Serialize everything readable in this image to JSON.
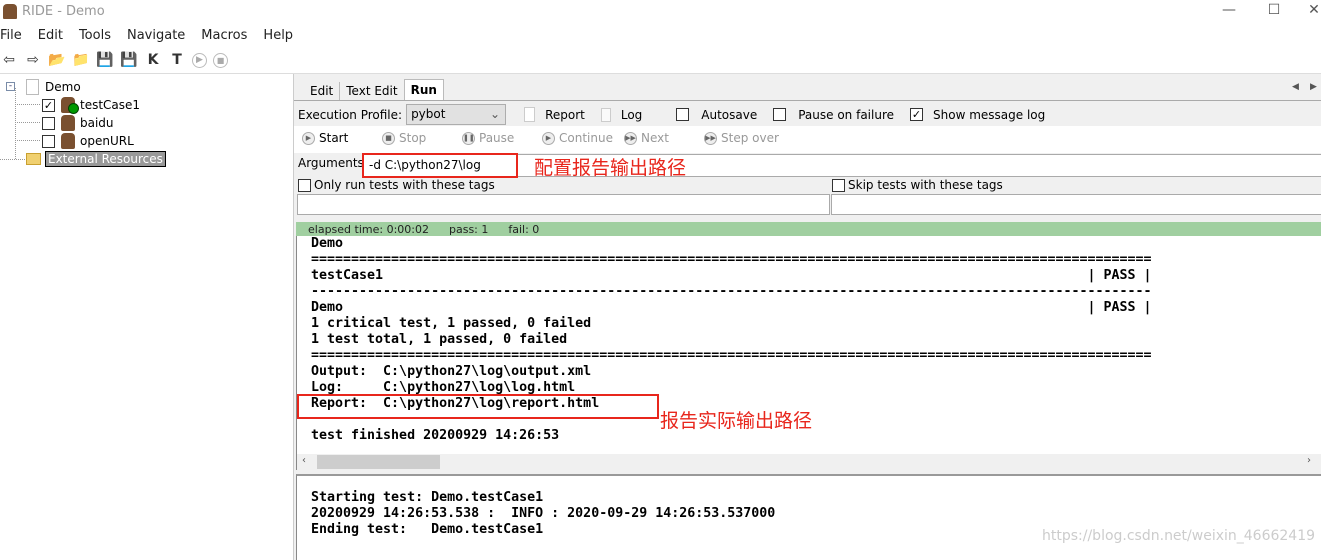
{
  "window": {
    "title": "RIDE - Demo",
    "controls": {
      "minimize": "—",
      "maximize": "☐",
      "close": "✕"
    }
  },
  "menu": [
    "File",
    "Edit",
    "Tools",
    "Navigate",
    "Macros",
    "Help"
  ],
  "toolbar": [
    {
      "icon": "back-arrow-icon",
      "glyph": "⇦"
    },
    {
      "icon": "forward-arrow-icon",
      "glyph": "⇨"
    },
    {
      "icon": "open-directory-icon",
      "glyph": "📂"
    },
    {
      "icon": "open-folder-icon",
      "glyph": "📁"
    },
    {
      "icon": "save-icon",
      "glyph": "💾"
    },
    {
      "icon": "save-all-icon",
      "glyph": "💾"
    },
    {
      "icon": "search-keywords-icon",
      "glyph": "K"
    },
    {
      "icon": "search-tests-icon",
      "glyph": "T"
    },
    {
      "icon": "run-icon",
      "glyph": "▶"
    },
    {
      "icon": "stop-icon",
      "glyph": "■"
    }
  ],
  "tree": {
    "root": "Demo",
    "items": [
      {
        "label": "testCase1",
        "checked": true,
        "status": "pass"
      },
      {
        "label": "baidu",
        "checked": false
      },
      {
        "label": "openURL",
        "checked": false
      }
    ],
    "external": "External Resources"
  },
  "tabs": [
    "Edit",
    "Text Edit",
    "Run"
  ],
  "tab_nav": {
    "left": "◀",
    "right": "▶"
  },
  "run": {
    "profile_label": "Execution Profile:",
    "profile_value": "pybot",
    "report": "Report",
    "log": "Log",
    "autosave": "Autosave",
    "autosave_checked": false,
    "pause_on_failure": "Pause on failure",
    "pause_checked": false,
    "show_message_log": "Show message log",
    "show_checked": true,
    "buttons": [
      "Start",
      "Stop",
      "Pause",
      "Continue",
      "Next",
      "Step over"
    ],
    "arguments_label": "Arguments:",
    "arguments_value": "-d C:\\python27\\log",
    "arguments_note": "配置报告输出路径",
    "only_run_tags": "Only run tests with these tags",
    "skip_tags": "Skip tests with these tags",
    "status": {
      "elapsed": "elapsed time: 0:00:02",
      "pass": "pass: 1",
      "fail": "fail: 0",
      "color": "#a0cfa0"
    },
    "output": {
      "l1": "Demo",
      "sep_eq": "=========================================================================================================",
      "l3": {
        "name": "testCase1",
        "status": "| PASS |"
      },
      "sep_dash": "---------------------------------------------------------------------------------------------------------",
      "l5": {
        "name": "Demo",
        "status": "| PASS |"
      },
      "l6": "1 critical test, 1 passed, 0 failed",
      "l7": "1 test total, 1 passed, 0 failed",
      "l9": "Output:  C:\\python27\\log\\output.xml",
      "l10": "Log:     C:\\python27\\log\\log.html",
      "l11": "Report:  C:\\python27\\log\\report.html",
      "l13": "test finished 20200929 14:26:53"
    },
    "report_note": "报告实际输出路径",
    "message_log": [
      "Starting test: Demo.testCase1",
      "20200929 14:26:53.538 :  INFO : 2020-09-29 14:26:53.537000",
      "Ending test:   Demo.testCase1"
    ]
  },
  "watermark": "https://blog.csdn.net/weixin_46662419"
}
